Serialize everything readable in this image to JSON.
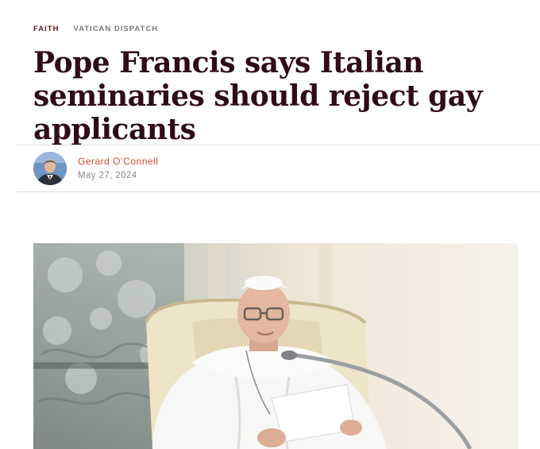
{
  "breadcrumbs": {
    "category": "FAITH",
    "section": "VATICAN DISPATCH"
  },
  "article": {
    "headline": "Pope Francis says Italian seminaries should reject gay applicants",
    "author": "Gerard O’Connell",
    "date": "May 27, 2024"
  },
  "colors": {
    "headline": "#2f0d12",
    "category": "#5b1a1a",
    "author": "#d24a2e",
    "date": "#8a8a8a"
  },
  "icons": {
    "avatar": "author-photo",
    "hero": "photo"
  }
}
